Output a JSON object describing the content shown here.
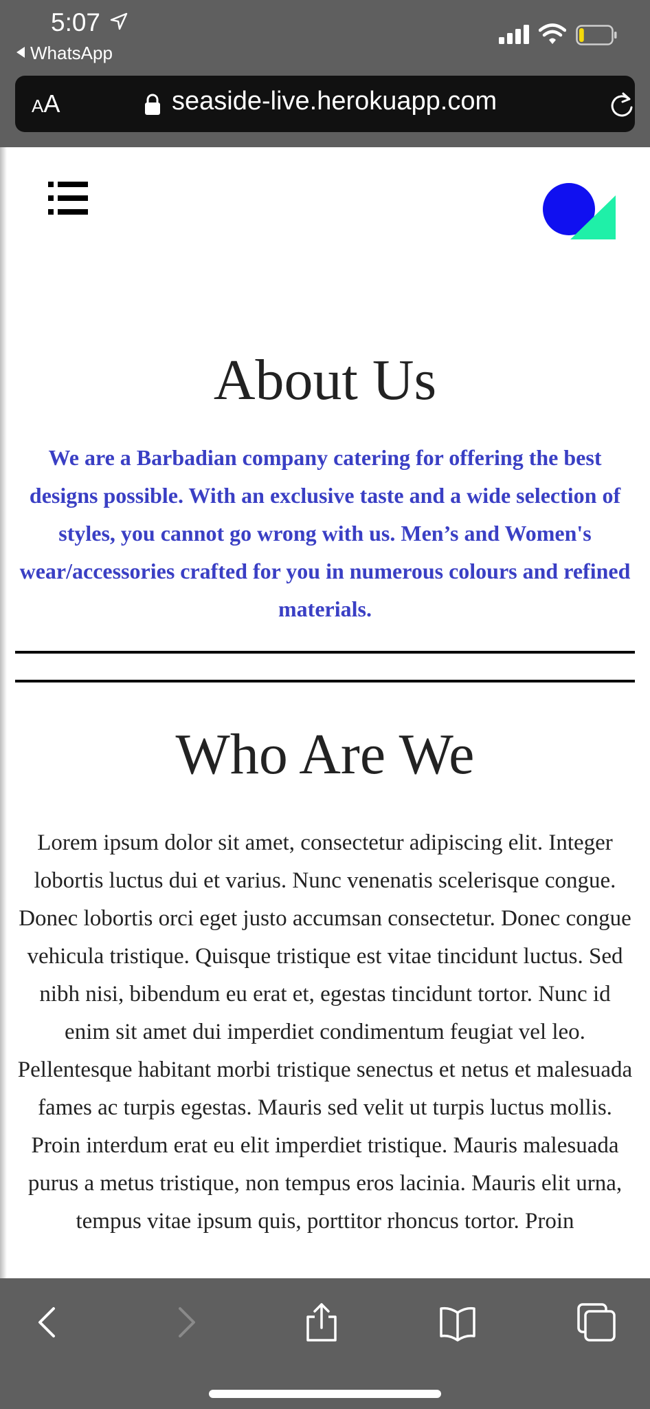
{
  "status_bar": {
    "time": "5:07",
    "back_app": "WhatsApp"
  },
  "browser": {
    "text_size_small": "A",
    "text_size_big": "A",
    "url": "seaside-live.herokuapp.com"
  },
  "site": {
    "about_heading": "About Us",
    "about_text": "We are a Barbadian company catering for offering the best designs possible. With an exclusive taste and a wide selection of styles, you cannot go wrong with us. Men’s and Women's wear/accessories crafted for you in numerous colours and refined materials.",
    "who_heading": "Who Are We",
    "who_text": "Lorem ipsum dolor sit amet, consectetur adipiscing elit. Integer lobortis luctus dui et varius. Nunc venenatis scelerisque congue. Donec lobortis orci eget justo accumsan consectetur. Donec congue vehicula tristique. Quisque tristique est vitae tincidunt luctus. Sed nibh nisi, bibendum eu erat et, egestas tincidunt tortor. Nunc id enim sit amet dui imperdiet condimentum feugiat vel leo. Pellentesque habitant morbi tristique senectus et netus et malesuada fames ac turpis egestas. Mauris sed velit ut turpis luctus mollis. Proin interdum erat eu elit imperdiet tristique. Mauris malesuada purus a metus tristique, non tempus eros lacinia. Mauris elit urna, tempus vitae ipsum quis, porttitor rhoncus tortor. Proin"
  },
  "icons": {
    "status": [
      "location-arrow-icon",
      "signal-icon",
      "wifi-icon",
      "battery-icon"
    ],
    "browser": [
      "lock-icon",
      "reload-icon"
    ],
    "site": [
      "menu-icon",
      "logo-icon"
    ],
    "toolbar": [
      "back-icon",
      "forward-icon",
      "share-icon",
      "bookmarks-icon",
      "tabs-icon"
    ]
  },
  "colors": {
    "chrome_gray": "#5f5f5f",
    "address_bar": "#111111",
    "about_text": "#3a3fc4",
    "logo_circle": "#1010f0",
    "logo_triangle": "#1ff0a8",
    "battery_level": "#f5d90a"
  },
  "battery_level_fraction": 0.15
}
